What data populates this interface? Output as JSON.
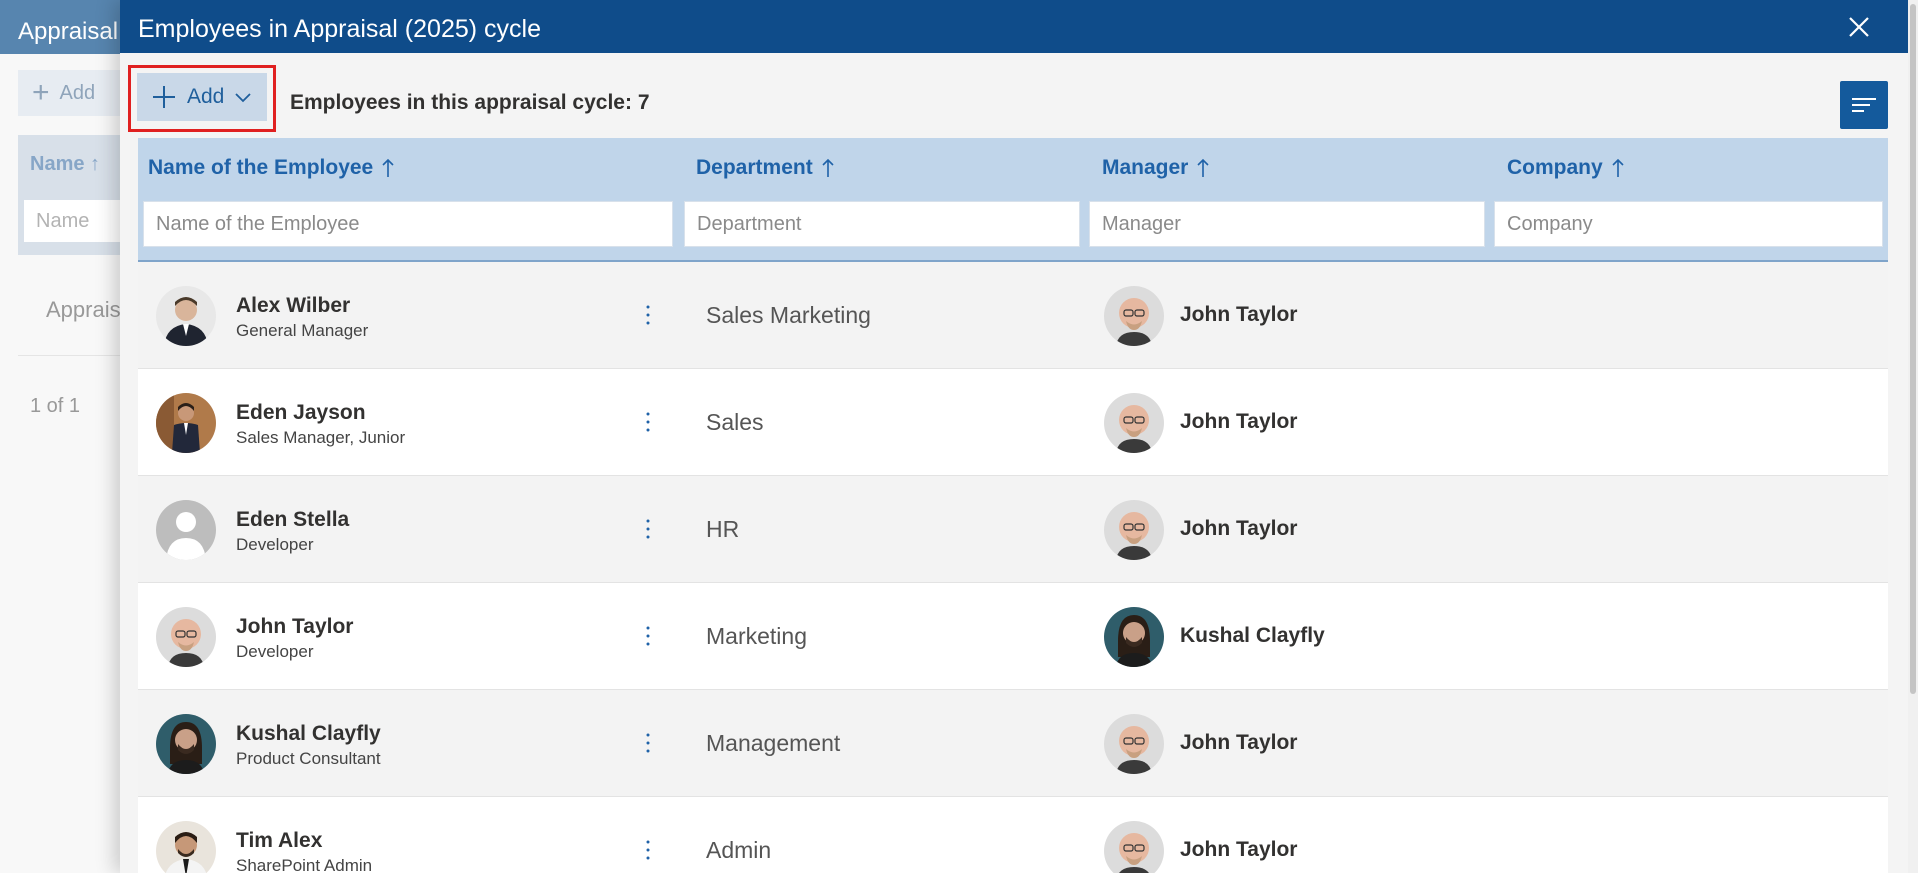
{
  "background": {
    "title": "Appraisal",
    "add_label": "Add",
    "name_col": "Name",
    "name_placeholder": "Name",
    "row_text": "Apprais",
    "pager": "1 of 1"
  },
  "panel": {
    "title": "Employees in Appraisal (2025) cycle",
    "add_label": "Add",
    "count_text": "Employees in this appraisal cycle: 7"
  },
  "columns": [
    {
      "label": "Name of the Employee",
      "placeholder": "Name of the Employee"
    },
    {
      "label": "Department",
      "placeholder": "Department"
    },
    {
      "label": "Manager",
      "placeholder": "Manager"
    },
    {
      "label": "Company",
      "placeholder": "Company"
    }
  ],
  "rows": [
    {
      "name": "Alex Wilber",
      "title": "General Manager",
      "department": "Sales Marketing",
      "manager": "John Taylor",
      "company": ""
    },
    {
      "name": "Eden Jayson",
      "title": "Sales Manager, Junior",
      "department": "Sales",
      "manager": "John Taylor",
      "company": ""
    },
    {
      "name": "Eden Stella",
      "title": "Developer",
      "department": "HR",
      "manager": "John Taylor",
      "company": ""
    },
    {
      "name": "John Taylor",
      "title": "Developer",
      "department": "Marketing",
      "manager": "Kushal Clayfly",
      "company": ""
    },
    {
      "name": "Kushal Clayfly",
      "title": "Product Consultant",
      "department": "Management",
      "manager": "John Taylor",
      "company": ""
    },
    {
      "name": "Tim Alex",
      "title": "SharePoint Admin",
      "department": "Admin",
      "manager": "John Taylor",
      "company": ""
    }
  ],
  "colors": {
    "header": "#0f4c8a",
    "accent": "#1f62a8",
    "highlight": "#e02020"
  }
}
